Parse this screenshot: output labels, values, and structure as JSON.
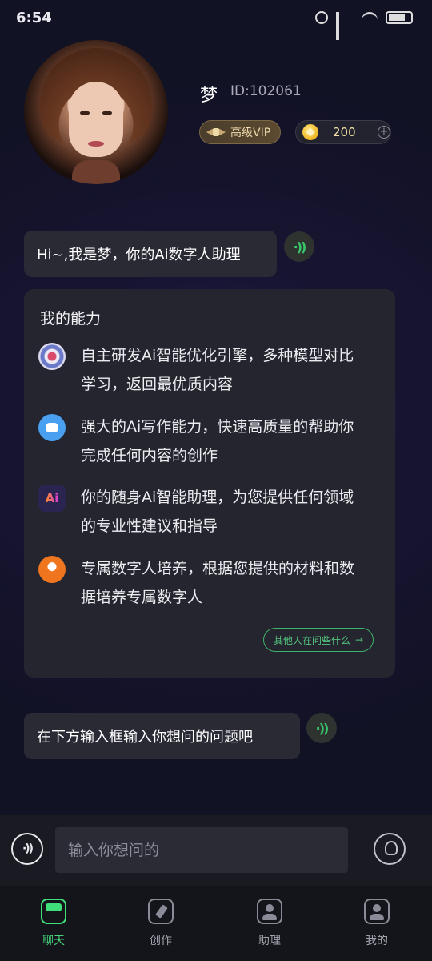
{
  "status_bar": {
    "time": "6:54"
  },
  "profile": {
    "name": "梦",
    "id_text": "ID:102061",
    "vip_label": "高级VIP",
    "coins": "200",
    "coin_add": "+"
  },
  "chat": {
    "greeting": "Hi~,我是梦，你的Ai数字人助理",
    "prompt_hint": "在下方输入框输入你想问的问题吧",
    "voice_glyph": "·))"
  },
  "capabilities": {
    "title": "我的能力",
    "items": [
      {
        "icon": "brain-engine-icon",
        "text": "自主研发Ai智能优化引擎，多种模型对比学习，返回最优质内容"
      },
      {
        "icon": "robot-writer-icon",
        "text": "强大的Ai写作能力，快速高质量的帮助你完成任何内容的创作"
      },
      {
        "icon": "ai-assistant-icon",
        "text": "你的随身Ai智能助理，为您提供任何领域的专业性建议和指导"
      },
      {
        "icon": "digital-person-icon",
        "text": "专属数字人培养，根据您提供的材料和数据培养专属数字人"
      }
    ],
    "ai_badge": "Ai",
    "others_button": "其他人在问些什么",
    "others_arrow": "→"
  },
  "input_bar": {
    "placeholder": "输入你想问的",
    "mic_glyph": "·))"
  },
  "tabs": [
    {
      "label": "聊天",
      "icon": "chat-icon",
      "active": true
    },
    {
      "label": "创作",
      "icon": "create-pen-icon",
      "active": false
    },
    {
      "label": "助理",
      "icon": "assistant-icon",
      "active": false
    },
    {
      "label": "我的",
      "icon": "profile-icon",
      "active": false
    }
  ],
  "colors": {
    "accent_green": "#3fe07a",
    "bubble_bg": "#2a2a35",
    "vip_gold": "#f0dcae"
  }
}
